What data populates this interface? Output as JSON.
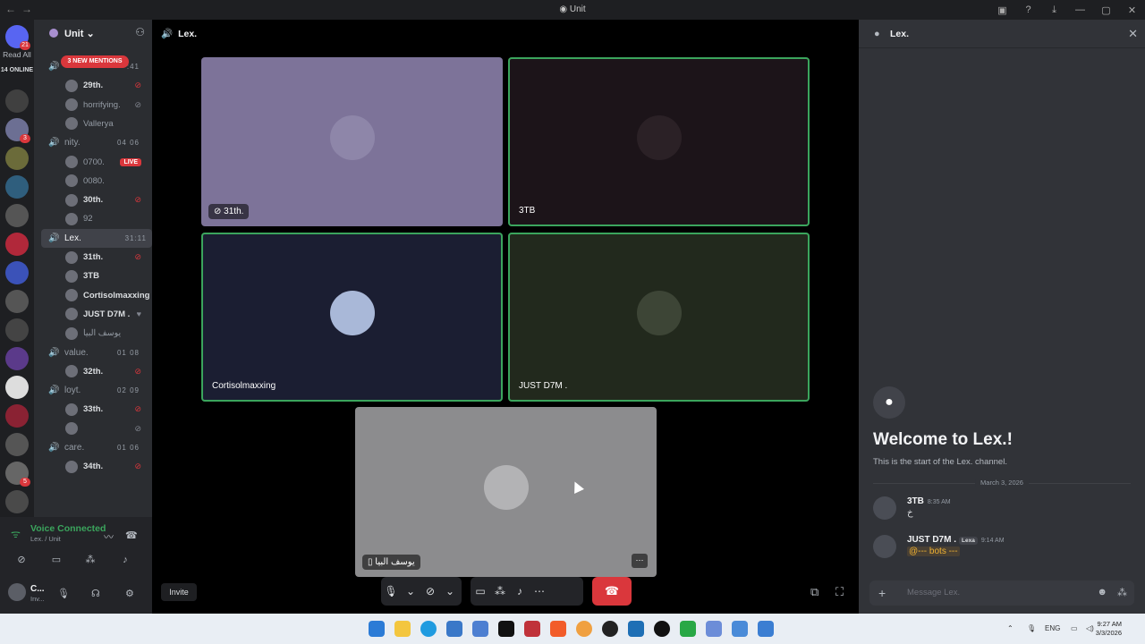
{
  "window": {
    "title": "Unit"
  },
  "servers": {
    "home_badge": "21",
    "read_all": "Read All",
    "online": "14 ONLINE",
    "icons": [
      {
        "name": "discord-home-icon",
        "color": "#5865f2",
        "badge": "21"
      },
      {
        "name": "server-icon-1",
        "color": "#404040",
        "badge": ""
      },
      {
        "name": "server-icon-unit",
        "color": "#6c6f93",
        "badge": "3"
      },
      {
        "name": "server-icon-3",
        "color": "#6b6b3a",
        "badge": ""
      },
      {
        "name": "server-icon-ocean",
        "color": "#2f5e7d",
        "badge": ""
      },
      {
        "name": "server-icon-5",
        "color": "#555",
        "badge": ""
      },
      {
        "name": "server-icon-6",
        "color": "#b1283a",
        "badge": ""
      },
      {
        "name": "server-icon-7",
        "color": "#3b52b8",
        "badge": ""
      },
      {
        "name": "server-icon-8",
        "color": "#555",
        "badge": ""
      },
      {
        "name": "server-icon-9",
        "color": "#444",
        "badge": ""
      },
      {
        "name": "server-icon-10",
        "color": "#5b3a8a",
        "badge": ""
      },
      {
        "name": "server-icon-11",
        "color": "#ddd",
        "badge": ""
      },
      {
        "name": "server-icon-12",
        "color": "#8a2233",
        "badge": ""
      },
      {
        "name": "server-icon-13",
        "color": "#555",
        "badge": ""
      },
      {
        "name": "server-icon-14",
        "color": "#666",
        "badge": "5"
      },
      {
        "name": "server-icon-15",
        "color": "#4a4a4a",
        "badge": ""
      }
    ]
  },
  "guild": {
    "name": "Unit",
    "new_mentions": "3 NEW MENTIONS"
  },
  "channel_list": [
    {
      "type": "chan",
      "name": "",
      "count": ":41"
    },
    {
      "type": "user",
      "name": "29th.",
      "icon": "deafen-icon",
      "dim": false
    },
    {
      "type": "user",
      "name": "horrifying.",
      "icon": "mute-icon",
      "dim": true
    },
    {
      "type": "user",
      "name": "Vallerya",
      "icon": "",
      "dim": true
    },
    {
      "type": "chan",
      "name": "nity.",
      "count": "04  06"
    },
    {
      "type": "user",
      "name": "0700.",
      "icon": "live",
      "dim": true
    },
    {
      "type": "user",
      "name": "0080.",
      "icon": "",
      "dim": true
    },
    {
      "type": "user",
      "name": "30th.",
      "icon": "deafen-icon",
      "dim": false
    },
    {
      "type": "user",
      "name": "92",
      "icon": "",
      "dim": true
    },
    {
      "type": "chan",
      "name": "Lex.",
      "count": "31:11",
      "active": true
    },
    {
      "type": "user",
      "name": "31th.",
      "icon": "deafen-icon",
      "dim": false
    },
    {
      "type": "user",
      "name": "3TB",
      "icon": "",
      "dim": false
    },
    {
      "type": "user",
      "name": "Cortisolmaxxing",
      "icon": "",
      "dim": false
    },
    {
      "type": "user",
      "name": "JUST D7M .",
      "icon": "heart-icon",
      "dim": false
    },
    {
      "type": "user",
      "name": "يوسف البيا",
      "icon": "",
      "dim": true
    },
    {
      "type": "chan",
      "name": "value.",
      "count": "01  08"
    },
    {
      "type": "user",
      "name": "32th.",
      "icon": "deafen-icon",
      "dim": false
    },
    {
      "type": "chan",
      "name": "loyt.",
      "count": "02  09"
    },
    {
      "type": "user",
      "name": "33th.",
      "icon": "deafen-icon",
      "dim": false
    },
    {
      "type": "user",
      "name": "",
      "icon": "mute-icon",
      "dim": true
    },
    {
      "type": "chan",
      "name": "care.",
      "count": "01  06"
    },
    {
      "type": "user",
      "name": "34th.",
      "icon": "deafen-icon",
      "dim": false
    }
  ],
  "voice": {
    "status": "Voice Connected",
    "location": "Lex. / Unit",
    "user_name": "C...",
    "user_sub": "Inv..."
  },
  "stage": {
    "channel": "Lex.",
    "tiles": [
      {
        "label": "31th.",
        "bg": "#7d7399",
        "avatar": "#8e86a9",
        "speaking": false,
        "deafened": true
      },
      {
        "label": "3TB",
        "bg": "#1c1419",
        "avatar": "#2b2126",
        "speaking": true,
        "deafened": false
      },
      {
        "label": "Cortisolmaxxing",
        "bg": "#1b1e32",
        "avatar": "#a9b8d8",
        "speaking": true,
        "deafened": false
      },
      {
        "label": "JUST D7M .",
        "bg": "#22291d",
        "avatar": "#3d4536",
        "speaking": true,
        "deafened": false
      },
      {
        "label": "يوسف البيا",
        "bg": "#8c8c8e",
        "avatar": "#b3b3b5",
        "speaking": false,
        "deafened": false
      }
    ],
    "invite": "Invite"
  },
  "chat": {
    "channel": "Lex.",
    "welcome_title": "Welcome to Lex.!",
    "welcome_sub": "This is the start of the Lex. channel.",
    "date": "March 3, 2026",
    "messages": [
      {
        "author": "3TB",
        "time": "8:35 AM",
        "tag": "",
        "text": "خ",
        "mention": false
      },
      {
        "author": "JUST D7M .",
        "time": "9:14 AM",
        "tag": "Lexa",
        "text": "@--- bots --- ",
        "mention": true
      }
    ],
    "placeholder": "Message Lex."
  },
  "taskbar": {
    "lang": "ENG",
    "time": "9:27 AM",
    "date": "3/3/2026"
  }
}
